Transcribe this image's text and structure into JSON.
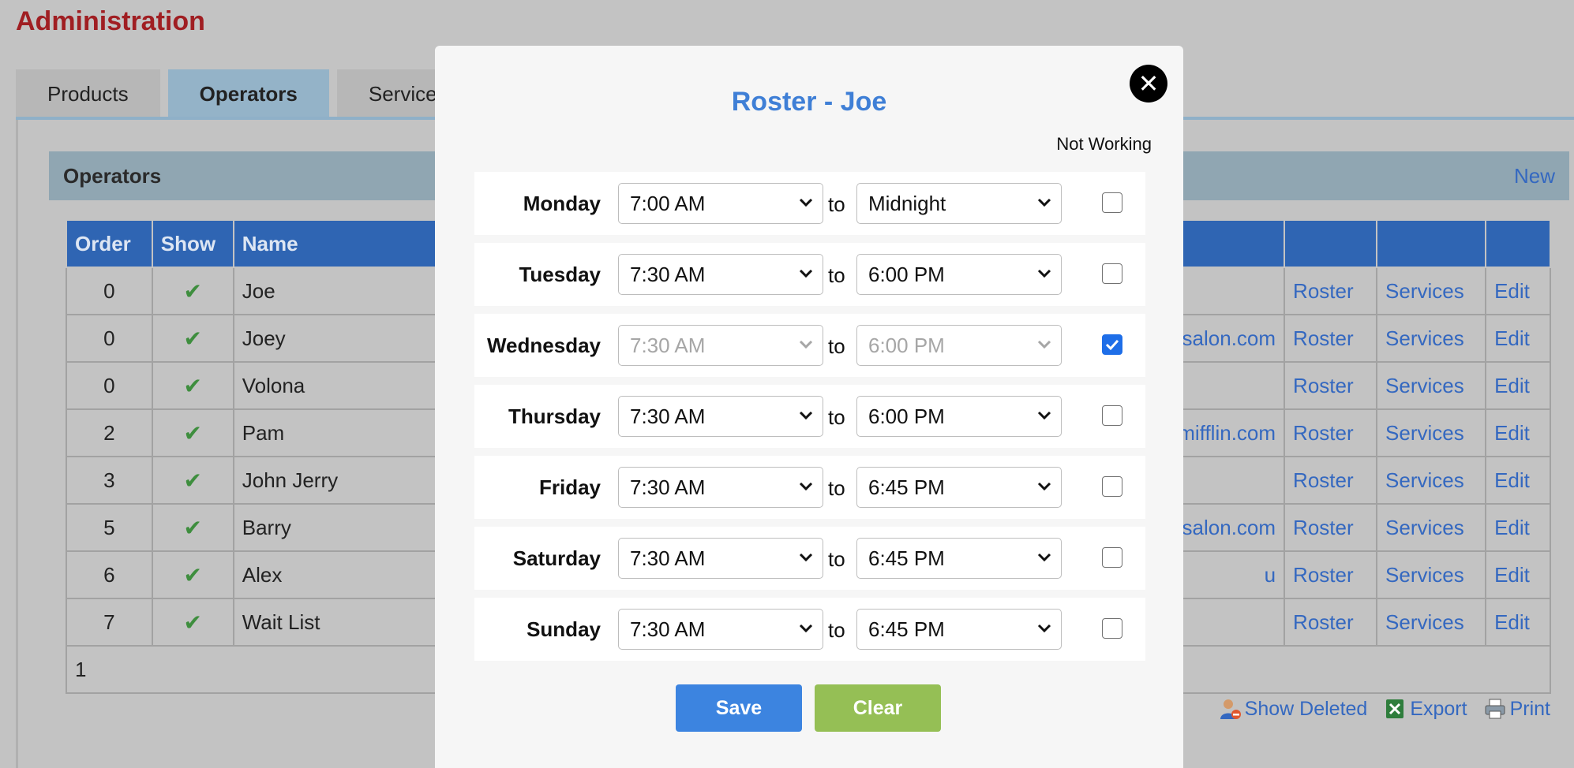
{
  "page": {
    "title": "Administration"
  },
  "tabs": [
    {
      "label": "Products"
    },
    {
      "label": "Operators"
    },
    {
      "label": "Services"
    }
  ],
  "section": {
    "title": "Operators",
    "new_label": "New"
  },
  "table": {
    "headers": [
      "Order",
      "Show",
      "Name"
    ],
    "rows": [
      {
        "order": "0",
        "name": "Joe",
        "email": ""
      },
      {
        "order": "0",
        "name": "Joey",
        "email": "salon.com"
      },
      {
        "order": "0",
        "name": "Volona",
        "email": ""
      },
      {
        "order": "2",
        "name": "Pam",
        "email": "dermifflin.com"
      },
      {
        "order": "3",
        "name": "John Jerry",
        "email": ""
      },
      {
        "order": "5",
        "name": "Barry",
        "email": "salon.com"
      },
      {
        "order": "6",
        "name": "Alex",
        "email": "u"
      },
      {
        "order": "7",
        "name": "Wait List",
        "email": ""
      }
    ],
    "row_links": {
      "roster": "Roster",
      "services": "Services",
      "edit": "Edit"
    },
    "page_number": "1"
  },
  "actions": {
    "show_deleted": "Show Deleted",
    "export": "Export",
    "print": "Print"
  },
  "modal": {
    "title": "Roster - Joe",
    "close_glyph": "✕",
    "not_working_label": "Not Working",
    "to_word": "to",
    "days": [
      {
        "day": "Monday",
        "from": "7:00 AM",
        "to": "Midnight",
        "not_working": false
      },
      {
        "day": "Tuesday",
        "from": "7:30 AM",
        "to": "6:00 PM",
        "not_working": false
      },
      {
        "day": "Wednesday",
        "from": "7:30 AM",
        "to": "6:00 PM",
        "not_working": true
      },
      {
        "day": "Thursday",
        "from": "7:30 AM",
        "to": "6:00 PM",
        "not_working": false
      },
      {
        "day": "Friday",
        "from": "7:30 AM",
        "to": "6:45 PM",
        "not_working": false
      },
      {
        "day": "Saturday",
        "from": "7:30 AM",
        "to": "6:45 PM",
        "not_working": false
      },
      {
        "day": "Sunday",
        "from": "7:30 AM",
        "to": "6:45 PM",
        "not_working": false
      }
    ],
    "save_label": "Save",
    "clear_label": "Clear"
  },
  "colors": {
    "title_red": "#a01e22",
    "header_blue": "#2f65b3",
    "link_blue": "#3468c0",
    "modal_title_blue": "#3f7fd6",
    "save_blue": "#3c84e0",
    "clear_green": "#95bf55",
    "check_green": "#3e8e3e"
  }
}
